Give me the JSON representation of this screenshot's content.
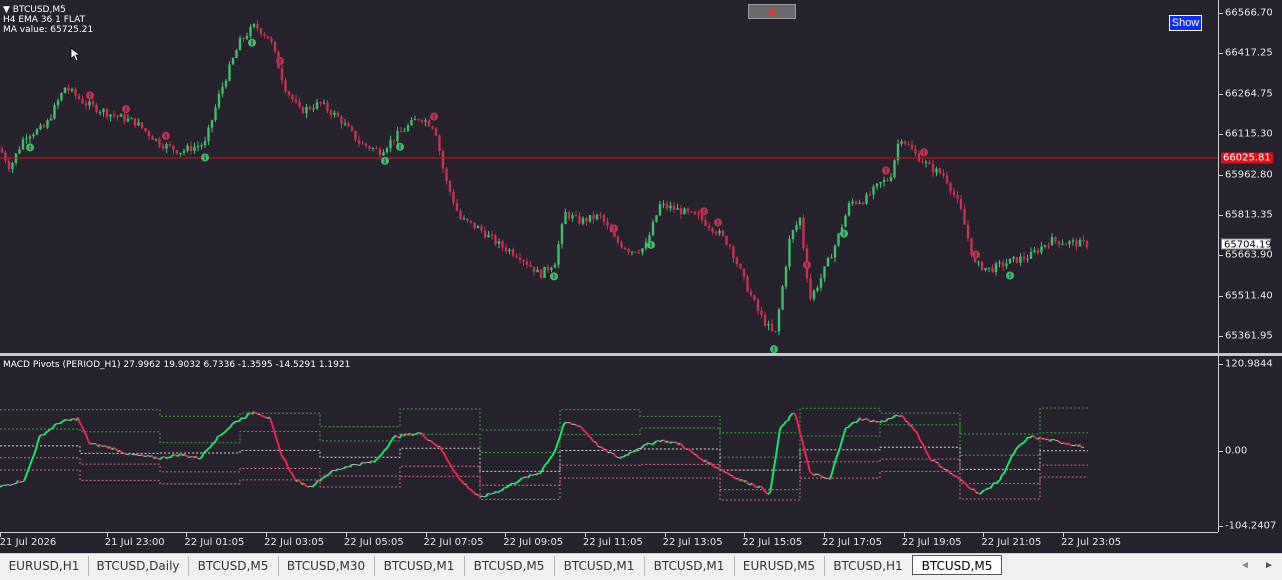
{
  "chart": {
    "symbol_label": "BTCUSD,M5",
    "info_line_1": "H4 EMA 36 1 FLAT",
    "info_line_2": "MA value: 65725.21",
    "bt_label": "bt",
    "show_label": "Show",
    "hline_price": "66025.81",
    "bid_price": "65704.19",
    "colors": {
      "background": "#26232e",
      "bull_candle": "#3fbf6a",
      "bear_candle": "#c8314f",
      "hline": "#e0101a",
      "macd_up": "#19e665",
      "macd_down": "#ee2450",
      "macd_neutral": "#b9b9b9"
    }
  },
  "price_axis": {
    "labels": [
      "66566.70",
      "66417.25",
      "66264.75",
      "66115.30",
      "65962.80",
      "65813.35",
      "65663.90",
      "65511.40",
      "65361.95"
    ],
    "range": [
      65310,
      66600
    ]
  },
  "indicator": {
    "title": "MACD Pivots (PERIOD_H1) 27.9962 19.9032 6.7336 -1.3595 -14.5291 1.1921",
    "axis_labels": [
      "120.9844",
      "0.00",
      "-104.2407"
    ],
    "range": [
      -104.2407,
      120.9844
    ]
  },
  "time_axis": {
    "labels": [
      "21 Jul 2026",
      "21 Jul 23:00",
      "22 Jul 01:05",
      "22 Jul 03:05",
      "22 Jul 05:05",
      "22 Jul 07:05",
      "22 Jul 09:05",
      "22 Jul 11:05",
      "22 Jul 13:05",
      "22 Jul 15:05",
      "22 Jul 17:05",
      "22 Jul 19:05",
      "22 Jul 21:05",
      "22 Jul 23:05"
    ]
  },
  "tabs": [
    {
      "label": "EURUSD,H1"
    },
    {
      "label": "BTCUSD,Daily"
    },
    {
      "label": "BTCUSD,M5"
    },
    {
      "label": "BTCUSD,M30"
    },
    {
      "label": "BTCUSD,M1"
    },
    {
      "label": "BTCUSD,M5"
    },
    {
      "label": "BTCUSD,M1"
    },
    {
      "label": "BTCUSD,M1"
    },
    {
      "label": "EURUSD,M5"
    },
    {
      "label": "BTCUSD,H1"
    },
    {
      "label": "BTCUSD,M5",
      "active": true
    }
  ],
  "chart_data": {
    "type": "line",
    "price_anchors": [
      [
        0,
        66060
      ],
      [
        10,
        65990
      ],
      [
        25,
        66110
      ],
      [
        45,
        66140
      ],
      [
        65,
        66290
      ],
      [
        85,
        66230
      ],
      [
        110,
        66190
      ],
      [
        135,
        66160
      ],
      [
        160,
        66080
      ],
      [
        180,
        66050
      ],
      [
        205,
        66080
      ],
      [
        220,
        66270
      ],
      [
        240,
        66460
      ],
      [
        255,
        66520
      ],
      [
        270,
        66470
      ],
      [
        285,
        66290
      ],
      [
        300,
        66200
      ],
      [
        320,
        66230
      ],
      [
        340,
        66170
      ],
      [
        360,
        66080
      ],
      [
        380,
        66050
      ],
      [
        400,
        66120
      ],
      [
        420,
        66180
      ],
      [
        435,
        66140
      ],
      [
        445,
        65950
      ],
      [
        460,
        65800
      ],
      [
        480,
        65760
      ],
      [
        500,
        65700
      ],
      [
        520,
        65660
      ],
      [
        540,
        65590
      ],
      [
        555,
        65640
      ],
      [
        565,
        65820
      ],
      [
        580,
        65790
      ],
      [
        600,
        65810
      ],
      [
        615,
        65720
      ],
      [
        630,
        65680
      ],
      [
        645,
        65690
      ],
      [
        660,
        65850
      ],
      [
        680,
        65830
      ],
      [
        700,
        65800
      ],
      [
        715,
        65760
      ],
      [
        730,
        65700
      ],
      [
        745,
        65560
      ],
      [
        760,
        65440
      ],
      [
        775,
        65360
      ],
      [
        790,
        65730
      ],
      [
        800,
        65800
      ],
      [
        810,
        65500
      ],
      [
        820,
        65570
      ],
      [
        835,
        65700
      ],
      [
        850,
        65860
      ],
      [
        865,
        65870
      ],
      [
        880,
        65930
      ],
      [
        890,
        65950
      ],
      [
        900,
        66110
      ],
      [
        915,
        66040
      ],
      [
        930,
        65990
      ],
      [
        945,
        65960
      ],
      [
        960,
        65840
      ],
      [
        975,
        65630
      ],
      [
        990,
        65610
      ],
      [
        1010,
        65640
      ],
      [
        1030,
        65660
      ],
      [
        1050,
        65720
      ],
      [
        1070,
        65710
      ],
      [
        1088,
        65704
      ]
    ],
    "macd_anchors": [
      [
        0,
        -50
      ],
      [
        25,
        -40
      ],
      [
        40,
        20
      ],
      [
        60,
        40
      ],
      [
        78,
        45
      ],
      [
        90,
        10
      ],
      [
        110,
        5
      ],
      [
        130,
        -5
      ],
      [
        160,
        -10
      ],
      [
        180,
        -5
      ],
      [
        200,
        -10
      ],
      [
        215,
        15
      ],
      [
        235,
        40
      ],
      [
        255,
        55
      ],
      [
        270,
        45
      ],
      [
        280,
        0
      ],
      [
        295,
        -40
      ],
      [
        310,
        -50
      ],
      [
        330,
        -30
      ],
      [
        350,
        -20
      ],
      [
        375,
        -15
      ],
      [
        395,
        20
      ],
      [
        420,
        25
      ],
      [
        440,
        5
      ],
      [
        460,
        -40
      ],
      [
        480,
        -65
      ],
      [
        500,
        -55
      ],
      [
        520,
        -40
      ],
      [
        540,
        -30
      ],
      [
        555,
        0
      ],
      [
        565,
        40
      ],
      [
        580,
        35
      ],
      [
        600,
        5
      ],
      [
        620,
        -10
      ],
      [
        640,
        5
      ],
      [
        660,
        15
      ],
      [
        680,
        10
      ],
      [
        700,
        -10
      ],
      [
        720,
        -25
      ],
      [
        740,
        -40
      ],
      [
        760,
        -50
      ],
      [
        770,
        -60
      ],
      [
        780,
        30
      ],
      [
        795,
        55
      ],
      [
        810,
        -30
      ],
      [
        830,
        -40
      ],
      [
        845,
        30
      ],
      [
        860,
        45
      ],
      [
        880,
        40
      ],
      [
        900,
        50
      ],
      [
        915,
        30
      ],
      [
        930,
        -10
      ],
      [
        950,
        -30
      ],
      [
        965,
        -45
      ],
      [
        980,
        -60
      ],
      [
        1000,
        -40
      ],
      [
        1015,
        0
      ],
      [
        1030,
        20
      ],
      [
        1050,
        15
      ],
      [
        1070,
        10
      ],
      [
        1085,
        5
      ]
    ]
  }
}
